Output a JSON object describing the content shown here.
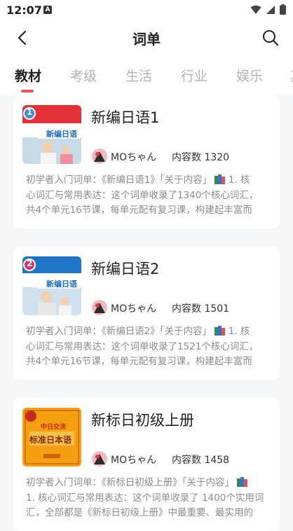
{
  "status_bar": {
    "time": "12:07",
    "notification_icon": "a-notification-icon",
    "wifi_icon": "wifi-icon",
    "signal_icon": "signal-icon",
    "battery_icon": "battery-icon"
  },
  "app_bar": {
    "title": "词单",
    "back_icon": "back-arrow-icon",
    "search_icon": "search-icon"
  },
  "tabs": [
    {
      "label": "教材",
      "active": true
    },
    {
      "label": "考级",
      "active": false
    },
    {
      "label": "生活",
      "active": false
    },
    {
      "label": "行业",
      "active": false
    },
    {
      "label": "娱乐",
      "active": false
    },
    {
      "label": "其",
      "active": false
    }
  ],
  "colors": {
    "accent": "#f0545a",
    "background": "#f5f6f8",
    "card": "#ffffff",
    "muted_text": "#8a8d93"
  },
  "cards": [
    {
      "title": "新编日语1",
      "author": "MOちゃん",
      "count_label": "内容数",
      "count": "1320",
      "cover_badge": "1",
      "cover_text": "新编日语",
      "desc_line1": "初学者入门词单：《新编日语1》「关于内容」",
      "desc_tail1": "1. 核",
      "desc_line2": "心词汇与常用表达：这个词单收录了1340个核心词汇，",
      "desc_line3": "共4个单元16节课，每单元配有复习课，构建起丰富而"
    },
    {
      "title": "新编日语2",
      "author": "MOちゃん",
      "count_label": "内容数",
      "count": "1501",
      "cover_badge": "2",
      "cover_text": "新编日语",
      "desc_line1": "初学者入门词单：《新编日语2》「关于内容」",
      "desc_tail1": "1. 核",
      "desc_line2": "心词汇与常用表达：这个词单收录了1521个核心词汇，",
      "desc_line3": "共4个单元16节课，每单元配有复习课，构建起丰富而"
    },
    {
      "title": "新标日初级上册",
      "author": "MOちゃん",
      "count_label": "内容数",
      "count": "1458",
      "cover_badge": "中日交流",
      "cover_text": "标准日本语",
      "desc_line1": "初学者入门词单：《新标日初级上册》「关于内容」",
      "desc_line2": "1. 核心词汇与常用表达：这个词单收录了 1400个实用词",
      "desc_line3": "汇，全部都是《新标日初级上册》中最重要、最实用的"
    }
  ]
}
